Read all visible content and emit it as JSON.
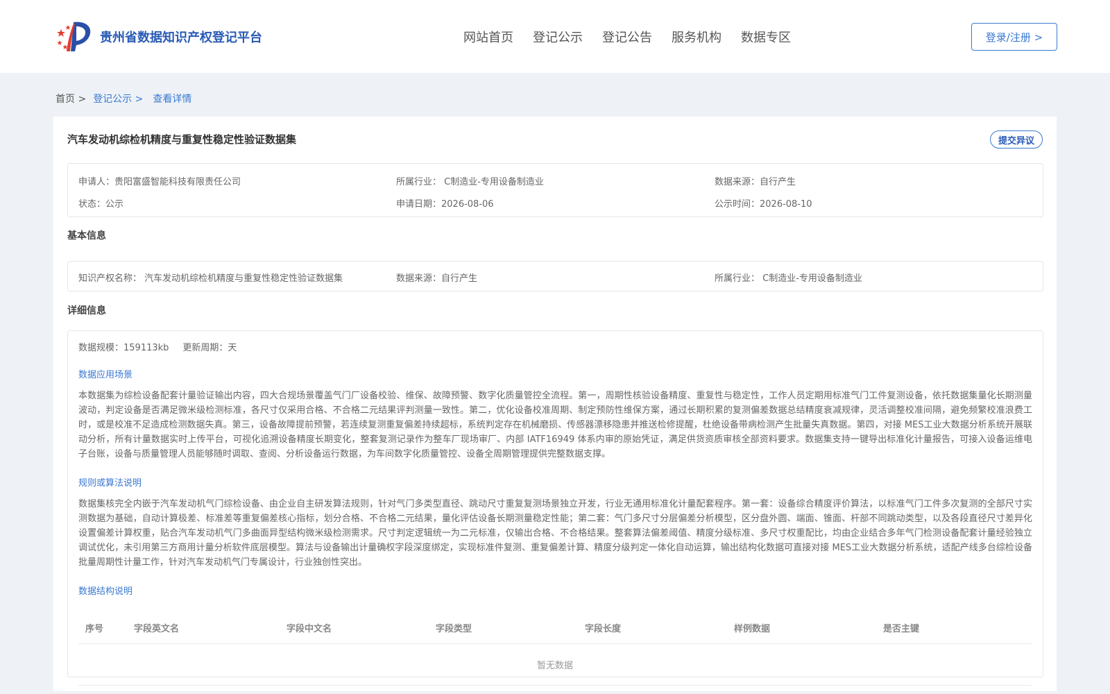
{
  "header": {
    "site_title": "贵州省数据知识产权登记平台",
    "nav": [
      "网站首页",
      "登记公示",
      "登记公告",
      "服务机构",
      "数据专区"
    ],
    "login_label": "登录/注册 >"
  },
  "breadcrumb": {
    "home": "首页 >",
    "level2": "登记公示 >",
    "current": "查看详情"
  },
  "record": {
    "title": "汽车发动机综检机精度与重复性稳定性验证数据集",
    "objection_label": "提交异议",
    "applicant": "申请人：贵阳富盛智能科技有限责任公司",
    "industry": "所属行业： C制造业-专用设备制造业",
    "source": "数据来源：自行产生",
    "status": "状态：公示",
    "apply_date": "申请日期：2026-08-06",
    "publish_date": "公示时间：2026-08-10"
  },
  "basic": {
    "heading": "基本信息",
    "ip_name": "知识产权名称： 汽车发动机综检机精度与重复性稳定性验证数据集",
    "source": "数据来源：自行产生",
    "industry": "所属行业： C制造业-专用设备制造业"
  },
  "detail": {
    "heading": "详细信息",
    "scale": "数据规模：159113kb",
    "update_cycle": "更新周期：天",
    "scenario_heading": "数据应用场景",
    "scenario_text": "本数据集为综检设备配套计量验证输出内容，四大合规场景覆盖气门厂设备校验、维保、故障预警、数字化质量管控全流程。第一，周期性核验设备精度、重复性与稳定性，工作人员定期用标准气门工件复测设备，依托数据集量化长期测量波动，判定设备是否满足微米级检测标准，各尺寸仅采用合格、不合格二元结果评判测量一致性。第二，优化设备校准周期、制定预防性维保方案，通过长期积累的复测偏差数据总结精度衰减规律，灵活调整校准间隔，避免频繁校准浪费工时，或是校准不足造成检测数据失真。第三，设备故障提前预警，若连续复测重复偏差持续超标，系统判定存在机械磨损、传感器漂移隐患并推送检修提醒，杜绝设备带病检测产生批量失真数据。第四，对接 MES工业大数据分析系统开展联动分析，所有计量数据实时上传平台，可视化追溯设备精度长期变化，整套复测记录作为整车厂现场审厂、内部 IATF16949 体系内审的原始凭证，满足供货资质审核全部资料要求。数据集支持一键导出标准化计量报告，可接入设备运维电子台账，设备与质量管理人员能够随时调取、查阅、分析设备运行数据，为车间数字化质量管控、设备全周期管理提供完整数据支撑。",
    "algorithm_heading": "规则或算法说明",
    "algorithm_text": "数据集核完全内嵌于汽车发动机气门综检设备、由企业自主研发算法规则，针对气门多类型直径、跳动尺寸重复复测场景独立开发，行业无通用标准化计量配套程序。第一套：设备综合精度评价算法，以标准气门工件多次复测的全部尺寸实测数据为基础，自动计算极差、标准差等重复偏差核心指标，划分合格、不合格二元结果，量化评估设备长期测量稳定性能；第二套：气门多尺寸分层偏差分析模型，区分盘外圆、端面、锥面、杆部不同跳动类型，以及各段直径尺寸差异化设置偏差计算权重，贴合汽车发动机气门多曲面异型结构微米级检测需求。尺寸判定逻辑统一为二元标准，仅输出合格、不合格结果。整套算法偏差阈值、精度分级标准、多尺寸权重配比，均由企业结合多年气门检测设备配套计量经验独立调试优化，未引用第三方商用计量分析软件底层模型。算法与设备输出计量确权字段深度绑定，实现标准件复测、重复偏差计算、精度分级判定一体化自动运算，输出结构化数据可直接对接 MES工业大数据分析系统，适配产线多台综检设备批量周期性计量工作，针对汽车发动机气门专属设计，行业独创性突出。",
    "structure_heading": "数据结构说明",
    "table_headers": [
      "序号",
      "字段英文名",
      "字段中文名",
      "字段类型",
      "字段长度",
      "样例数据",
      "是否主键"
    ],
    "empty_text": "暂无数据"
  },
  "colors": {
    "accent": "#3a78d2",
    "brand_title": "#2a5bb6",
    "page_bg": "#eef2f6"
  }
}
